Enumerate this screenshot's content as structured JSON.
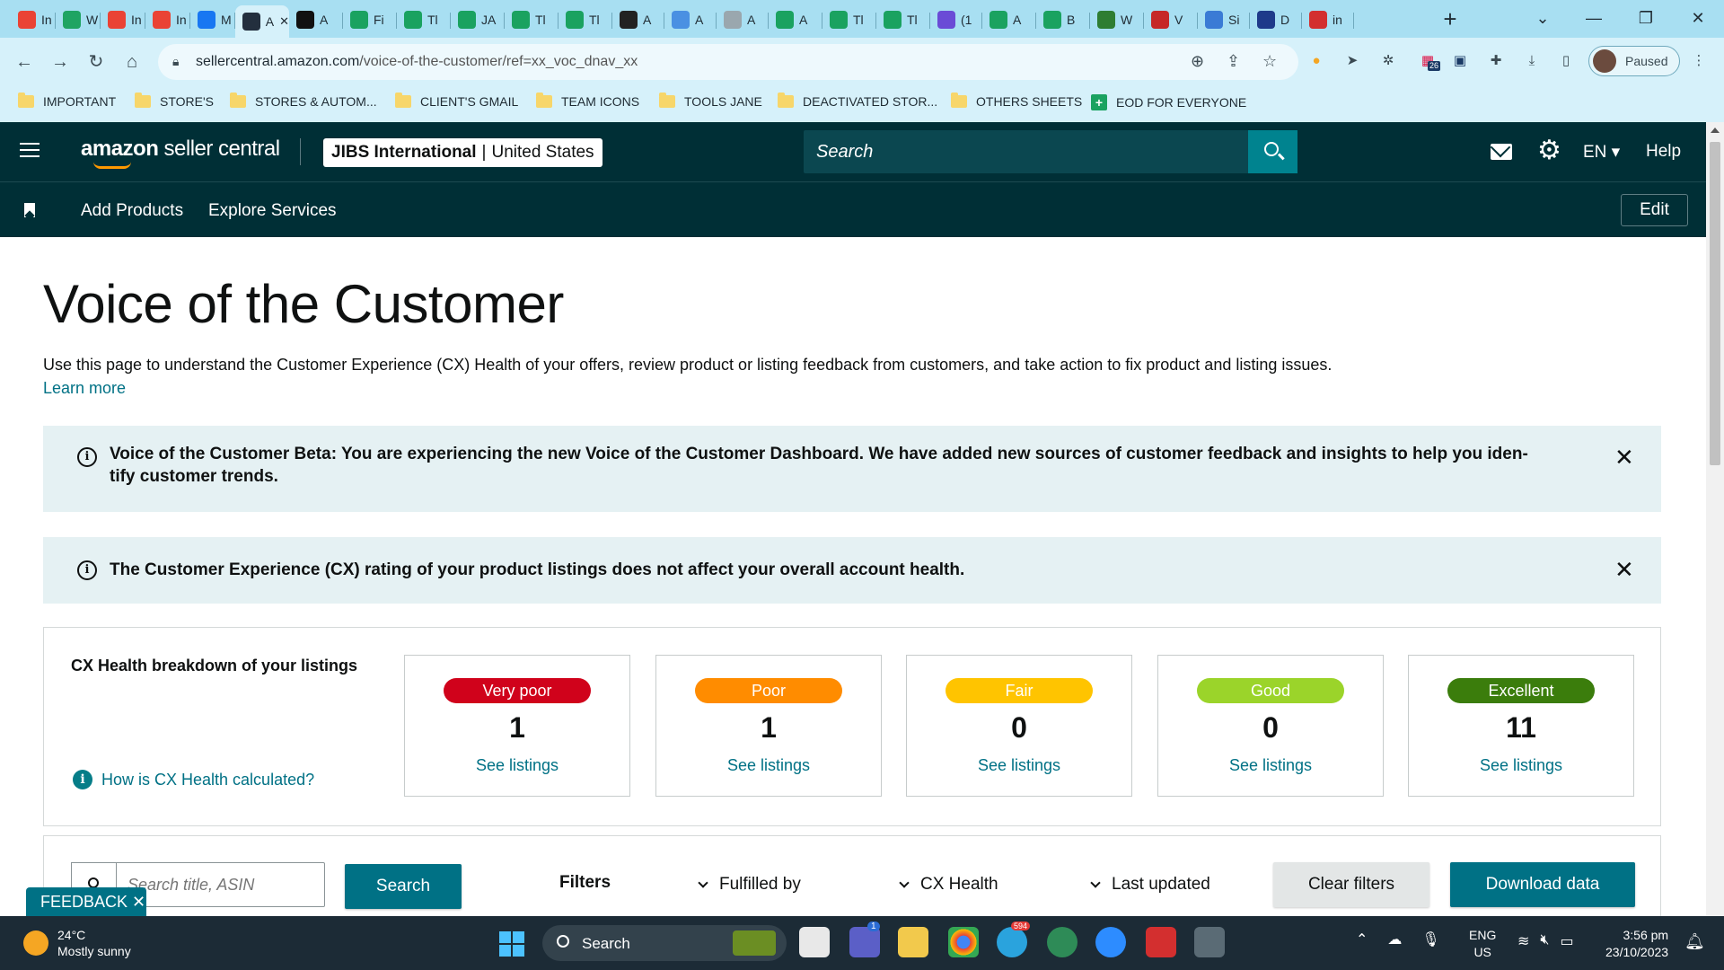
{
  "browser": {
    "tabs": [
      {
        "icon": "gmail-icon",
        "label": "In",
        "color": "#ea4335"
      },
      {
        "icon": "drive-icon",
        "label": "W",
        "color": "#1fa463"
      },
      {
        "icon": "gmail-icon",
        "label": "In",
        "color": "#ea4335"
      },
      {
        "icon": "gmail-icon",
        "label": "In",
        "color": "#ea4335"
      },
      {
        "icon": "facebook-icon",
        "label": "M",
        "color": "#1877f2"
      },
      {
        "icon": "amazon-icon",
        "label": "A",
        "color": "#232f3e",
        "active": true
      },
      {
        "icon": "amazon-icon",
        "label": "A",
        "color": "#111111"
      },
      {
        "icon": "sheets-icon",
        "label": "Fi",
        "color": "#1aa260"
      },
      {
        "icon": "sheets-icon",
        "label": "Tl",
        "color": "#1aa260"
      },
      {
        "icon": "sheets-icon",
        "label": "JA",
        "color": "#1aa260"
      },
      {
        "icon": "sheets-icon",
        "label": "Tl",
        "color": "#1aa260"
      },
      {
        "icon": "sheets-icon",
        "label": "Tl",
        "color": "#1aa260"
      },
      {
        "icon": "circle-icon",
        "label": "A",
        "color": "#222222"
      },
      {
        "icon": "pencil-icon",
        "label": "A",
        "color": "#4a90e2"
      },
      {
        "icon": "globe-icon",
        "label": "A",
        "color": "#9aa7ae"
      },
      {
        "icon": "sheets-icon",
        "label": "A",
        "color": "#1aa260"
      },
      {
        "icon": "sheets-icon",
        "label": "Tl",
        "color": "#1aa260"
      },
      {
        "icon": "sheets-icon",
        "label": "Tl",
        "color": "#1aa260"
      },
      {
        "icon": "chat-icon",
        "label": "(1",
        "color": "#6a4bd6"
      },
      {
        "icon": "sheets-icon",
        "label": "A",
        "color": "#1aa260"
      },
      {
        "icon": "sheets-icon",
        "label": "B",
        "color": "#1aa260"
      },
      {
        "icon": "w-icon",
        "label": "W",
        "color": "#2e7d32"
      },
      {
        "icon": "w-icon",
        "label": "V",
        "color": "#c62828"
      },
      {
        "icon": "cloud-icon",
        "label": "Si",
        "color": "#3a7bd5"
      },
      {
        "icon": "cloud-icon",
        "label": "D",
        "color": "#1e3a8a"
      },
      {
        "icon": "v-icon",
        "label": "in",
        "color": "#d32f2f"
      }
    ],
    "url_host": "sellercentral.amazon.com",
    "url_path": "/voice-of-the-customer/ref=xx_voc_dnav_xx",
    "profile_label": "Paused",
    "extension_badge": "26",
    "bookmarks": [
      {
        "label": "IMPORTANT",
        "type": "folder"
      },
      {
        "label": "STORE'S",
        "type": "folder"
      },
      {
        "label": "STORES & AUTOM...",
        "type": "folder"
      },
      {
        "label": "CLIENT'S GMAIL",
        "type": "folder"
      },
      {
        "label": "TEAM ICONS",
        "type": "folder"
      },
      {
        "label": "TOOLS JANE",
        "type": "folder"
      },
      {
        "label": "DEACTIVATED STOR...",
        "type": "folder"
      },
      {
        "label": "OTHERS SHEETS",
        "type": "folder"
      },
      {
        "label": "EOD FOR EVERYONE",
        "type": "sheet"
      }
    ]
  },
  "header": {
    "logo_bold": "amazon",
    "logo_rest": " seller central",
    "store_name": "JIBS International",
    "store_country": "United States",
    "search_placeholder": "Search",
    "language": "EN",
    "help": "Help"
  },
  "subnav": {
    "links": [
      "Add Products",
      "Explore Services"
    ],
    "edit": "Edit"
  },
  "main": {
    "title": "Voice of the Customer",
    "description": "Use this page to understand the Customer Experience (CX) Health of your offers, review product or listing feedback from customers, and take action to fix product and listing issues.",
    "learn_more": "Learn more",
    "beta_alert_line1": "Voice of the Customer Beta: You are experiencing the new Voice of the Customer Dashboard. We have added new sources of customer feedback and insights to help you iden-",
    "beta_alert_line2": "tify customer trends.",
    "cx_alert": "The Customer Experience (CX) rating of your product listings does not affect your overall account health.",
    "cx_panel_title": "CX Health breakdown of your listings",
    "cx_help_link": "How is CX Health calculated?",
    "cx_cards": [
      {
        "label": "Very poor",
        "count": "1",
        "link": "See listings",
        "color": "#d0021b"
      },
      {
        "label": "Poor",
        "count": "1",
        "link": "See listings",
        "color": "#ff8c00"
      },
      {
        "label": "Fair",
        "count": "0",
        "link": "See listings",
        "color": "#ffc400"
      },
      {
        "label": "Good",
        "count": "0",
        "link": "See listings",
        "color": "#9bd42a"
      },
      {
        "label": "Excellent",
        "count": "11",
        "link": "See listings",
        "color": "#3b7d0c"
      }
    ],
    "search_placeholder": "Search title, ASIN",
    "search_button": "Search",
    "filters_label": "Filters",
    "filter_dropdowns": [
      "Fulfilled by",
      "CX Health",
      "Last updated"
    ],
    "clear_filters": "Clear filters",
    "download_data": "Download data"
  },
  "feedback_button": "FEEDBACK",
  "taskbar": {
    "weather_temp": "24°C",
    "weather_desc": "Mostly sunny",
    "search_label": "Search",
    "lang_line1": "ENG",
    "lang_line2": "US",
    "time": "3:56 pm",
    "date": "23/10/2023",
    "telegram_badge": "594",
    "teams_badge": "1"
  }
}
